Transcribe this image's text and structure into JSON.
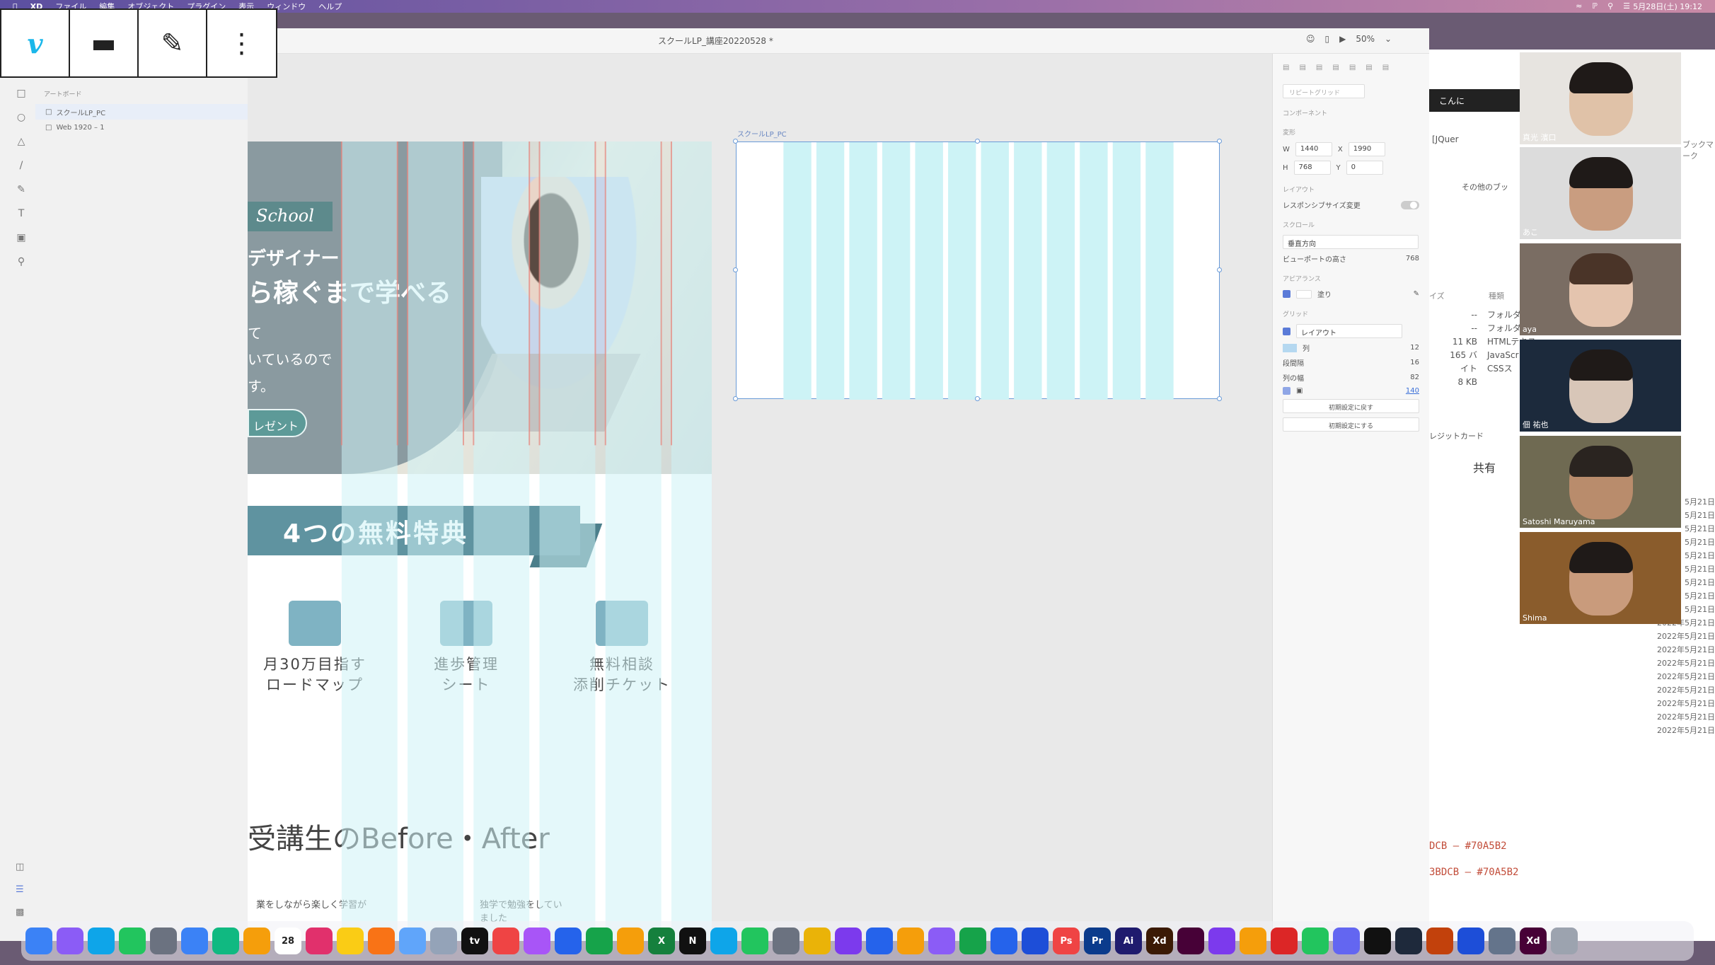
{
  "menubar": {
    "app": "XD",
    "items": [
      "ファイル",
      "編集",
      "オブジェクト",
      "プラグイン",
      "表示",
      "ウィンドウ",
      "ヘルプ"
    ],
    "datetime": "5月28日(土) 19:12"
  },
  "vimeo_toolbar": {
    "logo": "v"
  },
  "xd": {
    "document_title": "スクールLP_講座20220528 *",
    "zoom": "50%"
  },
  "layers": {
    "header": "アートボード",
    "items": [
      "スクールLP_PC",
      "Web 1920 – 1"
    ]
  },
  "artboard1": {
    "school_badge": "School",
    "hero_line1": "デザイナー",
    "hero_line2": "ら稼ぐまで学べる",
    "hero_line3": "て",
    "hero_line4": "いているので",
    "hero_line5": "す。",
    "hero_button": "レゼント",
    "ribbon_title": "4つの無料特典",
    "cards": [
      {
        "line1": "月30万目指す",
        "line2": "ロードマップ"
      },
      {
        "line1": "進歩管理",
        "line2": "シート"
      },
      {
        "line1": "無料相談",
        "line2": "添削チケット"
      }
    ],
    "before_after": "受講生のBefore・After",
    "mini1": "業をしながら楽しく学習が",
    "mini2": "独学で勉強をしていました"
  },
  "artboard2": {
    "label": "スクールLP_PC"
  },
  "props": {
    "repeat_grid": "リピートグリッド",
    "component": "コンポーネント",
    "transform": "変形",
    "w_label": "W",
    "w": "1440",
    "x_label": "X",
    "x": "1990",
    "h_label": "H",
    "h": "768",
    "y_label": "Y",
    "y": "0",
    "layout": "レイアウト",
    "responsive": "レスポンシブサイズ変更",
    "scroll": "スクロール",
    "scroll_value": "垂直方向",
    "viewport_label": "ビューポートの高さ",
    "viewport": "768",
    "appearance": "アピアランス",
    "fill": "塗り",
    "grid": "グリッド",
    "grid_type": "レイアウト",
    "columns_label": "列",
    "columns": "12",
    "gutter_label": "段間隔",
    "gutter": "16",
    "colwidth_label": "列の幅",
    "colwidth": "82",
    "margin": "140",
    "reset_default": "初期設定に戻す",
    "set_default": "初期設定にする"
  },
  "browser": {
    "tab": "こんに",
    "tab2": "[JQuer",
    "folder": "その他のブッ",
    "size_col": "イズ",
    "kind_col": "種類",
    "files": [
      {
        "size": "--",
        "kind": "フォルダ"
      },
      {
        "size": "--",
        "kind": "フォルダ"
      },
      {
        "size": "11 KB",
        "kind": "HTMLテキス"
      },
      {
        "size": "165 バイト",
        "kind": "JavaScr"
      },
      {
        "size": "8 KB",
        "kind": "CSSス"
      }
    ],
    "bookmarks": "ブックマーク",
    "credit": "レジットカード",
    "shared": "共有",
    "codes": [
      "DCB – #70A5B2",
      "3BDCB – #70A5B2"
    ],
    "dates": [
      "5月21日",
      "5月21日",
      "5月21日",
      "5月21日",
      "5月21日",
      "5月21日",
      "5月21日",
      "5月21日",
      "5月21日",
      "2022年5月21日",
      "2022年5月21日",
      "2022年5月21日",
      "2022年5月21日",
      "2022年5月21日",
      "2022年5月21日",
      "2022年5月21日",
      "2022年5月21日",
      "2022年5月21日"
    ]
  },
  "participants": [
    {
      "name": "真光 濱口"
    },
    {
      "name": "あこ"
    },
    {
      "name": "aya"
    },
    {
      "name": "佃 祐也"
    },
    {
      "name": "Satoshi Maruyama"
    },
    {
      "name": "Shima"
    }
  ],
  "dock": {
    "date_icon": "28",
    "apps": [
      "Finder",
      "Launchpad",
      "Safari",
      "Messages",
      "Calculator",
      "Mail",
      "Maps",
      "Photos",
      "Calendar",
      "Instagram",
      "Notes",
      "Reminders",
      "Files",
      "Preview",
      "TV",
      "Music",
      "Podcasts",
      "Keynote",
      "Numbers",
      "Pages",
      "Excel",
      "Notion",
      "App Store",
      "FaceTime",
      "System Settings",
      "Chrome",
      "Slack",
      "VS Code",
      "Cyberduck",
      "Messenger",
      "Meet",
      "Zoom",
      "Maps2",
      "Figma",
      "Photoshop",
      "Premiere",
      "Illustrator",
      "XD",
      "iMovie",
      "Sketch",
      "Acrobat",
      "LINE",
      "Discord",
      "Terminal",
      "Activity",
      "PowerPoint",
      "Word",
      "Finder2",
      "XD2",
      "Trash"
    ],
    "labels": {
      "ps": "Ps",
      "pr": "Pr",
      "ai": "Ai",
      "xd": "Xd",
      "tv": "tv",
      "n": "N",
      "x": "X"
    }
  },
  "colors": {
    "grid_column": "#cdf3f6",
    "selection": "#6a9bd8",
    "accent_teal": "#5f93a0",
    "code_red": "#c24d3a"
  }
}
